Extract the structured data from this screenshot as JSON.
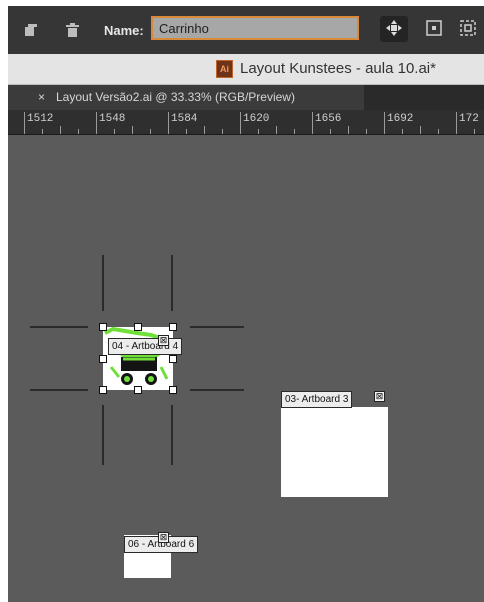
{
  "control_bar": {
    "name_label": "Name:",
    "name_value": "Carrinho",
    "icons": [
      "new-artboard-icon",
      "trash-icon",
      "move-artwork-icon",
      "reference-point-icon",
      "fit-artboard-icon"
    ]
  },
  "window": {
    "title": "Layout Kunstees - aula 10.ai*",
    "file_badge": "Ai"
  },
  "document_tab": {
    "close_glyph": "×",
    "label": "Layout Versão2.ai @ 33.33% (RGB/Preview)"
  },
  "ruler": {
    "labels": [
      "1512",
      "1548",
      "1584",
      "1620",
      "1656",
      "1692",
      "172"
    ]
  },
  "artboards": [
    {
      "id": "04",
      "label": "04 - Artboard 4",
      "selected": true
    },
    {
      "id": "03",
      "label": "03- Artboard 3",
      "selected": false
    },
    {
      "id": "06",
      "label": "06 - Artboard 6",
      "selected": false
    }
  ],
  "artboard_close_glyph": "⊠",
  "colors": {
    "canvas": "#5b5b5b",
    "control_bar": "#363636",
    "name_field_border": "#d78a3a",
    "selection_green": "#6fe03a"
  }
}
